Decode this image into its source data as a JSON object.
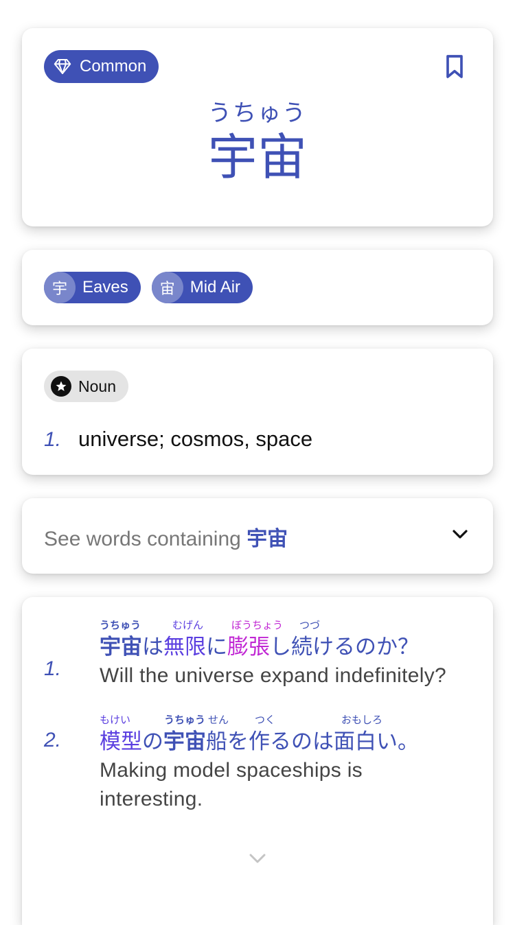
{
  "colors": {
    "accent": "#3f51b5",
    "accent_light": "#7986cb",
    "purple": "#5b3fe0",
    "magenta": "#c026d3",
    "chip_grey": "#e4e4e4"
  },
  "word": {
    "badge_icon": "diamond-icon",
    "badge_label": "Common",
    "bookmark_icon": "bookmark-icon",
    "reading": "うちゅう",
    "kanji": "宇宙"
  },
  "kanji_chips": [
    {
      "char": "宇",
      "meaning": "Eaves"
    },
    {
      "char": "宙",
      "meaning": "Mid Air"
    }
  ],
  "definition": {
    "pos_icon": "star-icon",
    "pos": "Noun",
    "senses": [
      {
        "num": "1.",
        "text": "universe; cosmos, space"
      }
    ]
  },
  "contains": {
    "prefix": "See words containing ",
    "word": "宇宙",
    "icon": "chevron-down-icon"
  },
  "examples": [
    {
      "num": "1.",
      "furigana": [
        "うちゅう",
        "むげん",
        "ぼうちょう",
        "つづ"
      ],
      "tokens": [
        "宇宙",
        "は",
        "無限",
        "に",
        "膨張",
        "し",
        "続",
        "けるのか？"
      ],
      "en": "Will the universe expand indefinitely?"
    },
    {
      "num": "2.",
      "furigana": [
        "もけい",
        "うちゅう",
        "せん",
        "つく",
        "おもしろ"
      ],
      "tokens": [
        "模型",
        "の",
        "宇宙",
        "船",
        "を",
        "作",
        "るのは",
        "面白",
        "い。"
      ],
      "en_line1": "Making model spaceships is",
      "en_line2": "interesting."
    }
  ],
  "more_icon": "chevron-down-icon"
}
